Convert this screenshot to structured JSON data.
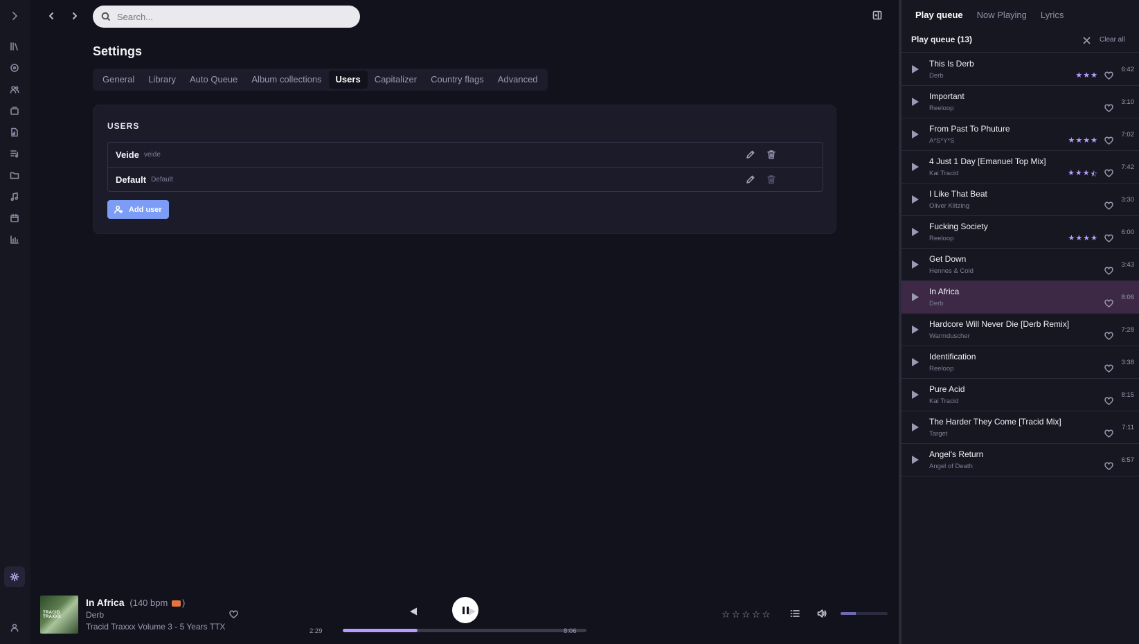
{
  "rail": {
    "items": [
      "expand",
      "library",
      "albums",
      "artists",
      "collections",
      "tracks",
      "playlists",
      "folders",
      "genres",
      "calendar",
      "statistics",
      "settings",
      "user"
    ]
  },
  "search": {
    "placeholder": "Search..."
  },
  "settings": {
    "title": "Settings",
    "tabs": [
      "General",
      "Library",
      "Auto Queue",
      "Album collections",
      "Users",
      "Capitalizer",
      "Country flags",
      "Advanced"
    ],
    "active_tab": "Users",
    "users_heading": "USERS",
    "users": [
      {
        "name": "Veide",
        "login": "veide"
      },
      {
        "name": "Default",
        "login": "Default"
      }
    ],
    "add_user_label": "Add user"
  },
  "right_panel": {
    "tabs": [
      "Play queue",
      "Now Playing",
      "Lyrics"
    ],
    "active_tab": "Play queue",
    "queue_title": "Play queue (13)",
    "clear_all_label": "Clear all",
    "tracks": [
      {
        "title": "This Is Derb",
        "artist": "Derb",
        "duration": "6:42",
        "rating": 3
      },
      {
        "title": "Important",
        "artist": "Reeloop",
        "duration": "3:10",
        "rating": 0
      },
      {
        "title": "From Past To Phuture",
        "artist": "A*S*Y*S",
        "duration": "7:02",
        "rating": 4
      },
      {
        "title": "4 Just 1 Day [Emanuel Top Mix]",
        "artist": "Kai Tracid",
        "duration": "7:42",
        "rating": 3.5
      },
      {
        "title": "I Like That Beat",
        "artist": "Oliver Klitzing",
        "duration": "3:30",
        "rating": 0
      },
      {
        "title": "Fucking Society",
        "artist": "Reeloop",
        "duration": "6:00",
        "rating": 4
      },
      {
        "title": "Get Down",
        "artist": "Hennes & Cold",
        "duration": "3:43",
        "rating": 0
      },
      {
        "title": "In Africa",
        "artist": "Derb",
        "duration": "8:06",
        "rating": 0,
        "current": true
      },
      {
        "title": "Hardcore Will Never Die [Derb Remix]",
        "artist": "Warmduscher",
        "duration": "7:28",
        "rating": 0
      },
      {
        "title": "Identification",
        "artist": "Reeloop",
        "duration": "3:38",
        "rating": 0
      },
      {
        "title": "Pure Acid",
        "artist": "Kai Tracid",
        "duration": "8:15",
        "rating": 0
      },
      {
        "title": "The Harder They Come [Tracid Mix]",
        "artist": "Target",
        "duration": "7:11",
        "rating": 0
      },
      {
        "title": "Angel's Return",
        "artist": "Angel of Death",
        "duration": "6:57",
        "rating": 0
      }
    ]
  },
  "player": {
    "title": "In Africa",
    "bpm": "(140 bpm",
    "bpm_close": ")",
    "artist": "Derb",
    "album": "Tracid Traxxx Volume 3 - 5 Years TTX",
    "cover_text": "TRACID TRAXXX",
    "elapsed": "2:29",
    "total": "8:06",
    "progress": 0.307,
    "volume": 0.33,
    "rating": 0
  },
  "colors": {
    "accent": "#b79cff",
    "button": "#7c9cf5",
    "current_row": "#3d2845",
    "bpm_flag": "#e8743b"
  }
}
